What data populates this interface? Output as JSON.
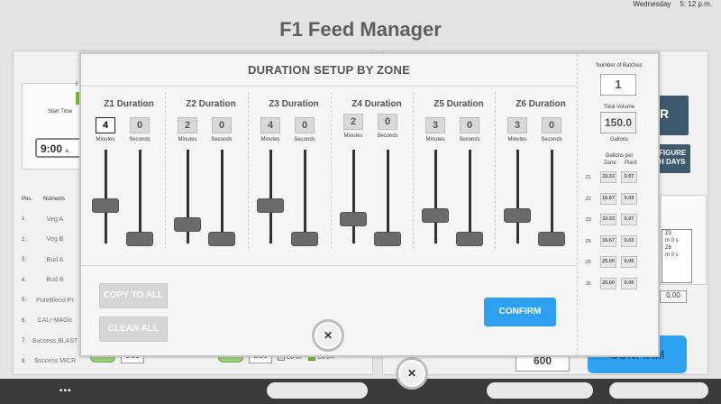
{
  "topbar": {
    "day": "Wednesday",
    "time": "5: 12 p.m."
  },
  "page": {
    "title": "F1 Feed Manager"
  },
  "background": {
    "left_letter": "I",
    "start_time_label": "Start Time",
    "start_time_value": "9:00",
    "start_time_ampm": "a.",
    "nutrients_header": {
      "pos": "Pos.",
      "name": "Nutrients"
    },
    "nutrients": [
      {
        "pos": "1.",
        "name": "Veg A"
      },
      {
        "pos": "2.",
        "name": "Veg B"
      },
      {
        "pos": "3.",
        "name": "Bud A"
      },
      {
        "pos": "4.",
        "name": "Bud B"
      },
      {
        "pos": "5.",
        "name": "PureBlend Pr"
      },
      {
        "pos": "6.",
        "name": "CALI-MAGic"
      },
      {
        "pos": "7.",
        "name": "Success BLAST"
      },
      {
        "pos": "8.",
        "name": "Success MICR"
      }
    ],
    "row8_val1": "0.00",
    "row8_val2": "0.00",
    "ec_up": "EC UP",
    "ec_dn": "EC DN",
    "dark_btn1": "R",
    "dark_btn2": "FIGURE\nH DAYS",
    "zone_z3": "Z3",
    "zone_z6": "Z6",
    "zone_m1": "m 0 s",
    "zone_m2": "m 0 s",
    "zone_val": "0.00",
    "value_600": "600",
    "confirm_label": "CONFIRM"
  },
  "modal": {
    "title": "DURATION SETUP BY ZONE",
    "minutes_label": "Minutes",
    "seconds_label": "Seconds",
    "zones": [
      {
        "title": "Z1 Duration",
        "minutes": "4",
        "seconds": "0",
        "min_level": 0.4,
        "sec_level": 0.05
      },
      {
        "title": "Z2 Duration",
        "minutes": "2",
        "seconds": "0",
        "min_level": 0.2,
        "sec_level": 0.05
      },
      {
        "title": "Z3 Duration",
        "minutes": "4",
        "seconds": "0",
        "min_level": 0.4,
        "sec_level": 0.05
      },
      {
        "title": "Z4 Duration",
        "minutes": "2",
        "seconds": "0",
        "min_level": 0.2,
        "sec_level": 0.05
      },
      {
        "title": "Z5 Duration",
        "minutes": "3",
        "seconds": "0",
        "min_level": 0.3,
        "sec_level": 0.05
      },
      {
        "title": "Z6 Duration",
        "minutes": "3",
        "seconds": "0",
        "min_level": 0.3,
        "sec_level": 0.05
      }
    ],
    "copy_to_all": "COPY TO ALL",
    "clear_all": "CLEAR ALL",
    "confirm": "CONFIRM",
    "side": {
      "batches_label": "Number of Batches",
      "batches_value": "1",
      "total_volume_label": "Total Volume",
      "total_volume_value": "150.0",
      "gallons_label": "Gallons",
      "gallons_per_label": "Gallons per",
      "zone_col": "Zone",
      "plant_col": "Plant",
      "rows": [
        {
          "zone": "Z1",
          "per_zone": "33.33",
          "per_plant": "0.07"
        },
        {
          "zone": "Z2",
          "per_zone": "16.67",
          "per_plant": "0.03"
        },
        {
          "zone": "Z3",
          "per_zone": "33.33",
          "per_plant": "0.07"
        },
        {
          "zone": "Z4",
          "per_zone": "16.67",
          "per_plant": "0.03"
        },
        {
          "zone": "Z5",
          "per_zone": "25.00",
          "per_plant": "0.05"
        },
        {
          "zone": "Z6",
          "per_zone": "25.00",
          "per_plant": "0.05"
        }
      ]
    }
  },
  "close_glyph": "✕"
}
